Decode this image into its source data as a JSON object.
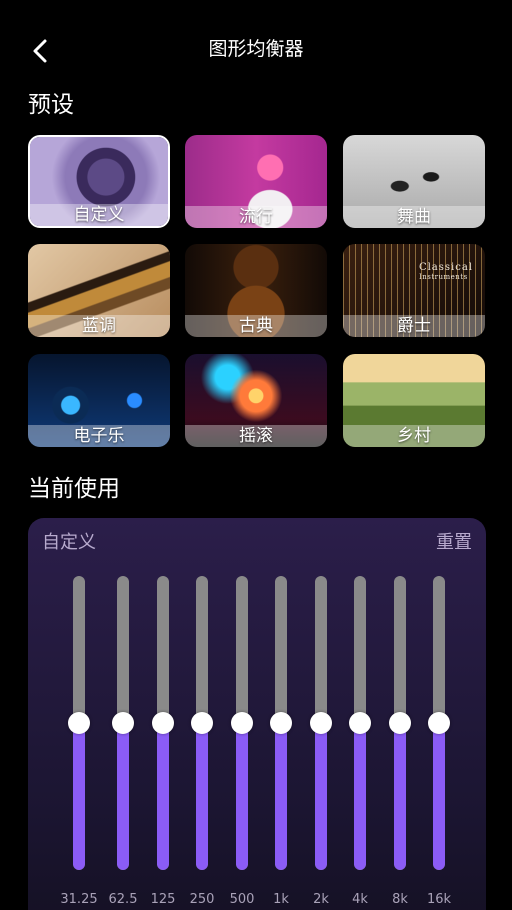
{
  "header": {
    "title": "图形均衡器",
    "back_icon": "chevron-left-icon"
  },
  "presets_title": "预设",
  "presets": [
    {
      "label": "自定义",
      "selected": true
    },
    {
      "label": "流行",
      "selected": false
    },
    {
      "label": "舞曲",
      "selected": false
    },
    {
      "label": "蓝调",
      "selected": false
    },
    {
      "label": "古典",
      "selected": false
    },
    {
      "label": "爵士",
      "selected": false
    },
    {
      "label": "电子乐",
      "selected": false
    },
    {
      "label": "摇滚",
      "selected": false
    },
    {
      "label": "乡村",
      "selected": false
    }
  ],
  "jazz_art_text": {
    "line1": "Classical",
    "line2": "Instruments"
  },
  "current_title": "当前使用",
  "equalizer": {
    "preset_name": "自定义",
    "reset_label": "重置",
    "accent_color": "#8b5cf6",
    "bands": [
      {
        "freq": "31.25",
        "level": 0.5
      },
      {
        "freq": "62.5",
        "level": 0.5
      },
      {
        "freq": "125",
        "level": 0.5
      },
      {
        "freq": "250",
        "level": 0.5
      },
      {
        "freq": "500",
        "level": 0.5
      },
      {
        "freq": "1k",
        "level": 0.5
      },
      {
        "freq": "2k",
        "level": 0.5
      },
      {
        "freq": "4k",
        "level": 0.5
      },
      {
        "freq": "8k",
        "level": 0.5
      },
      {
        "freq": "16k",
        "level": 0.5
      }
    ]
  }
}
